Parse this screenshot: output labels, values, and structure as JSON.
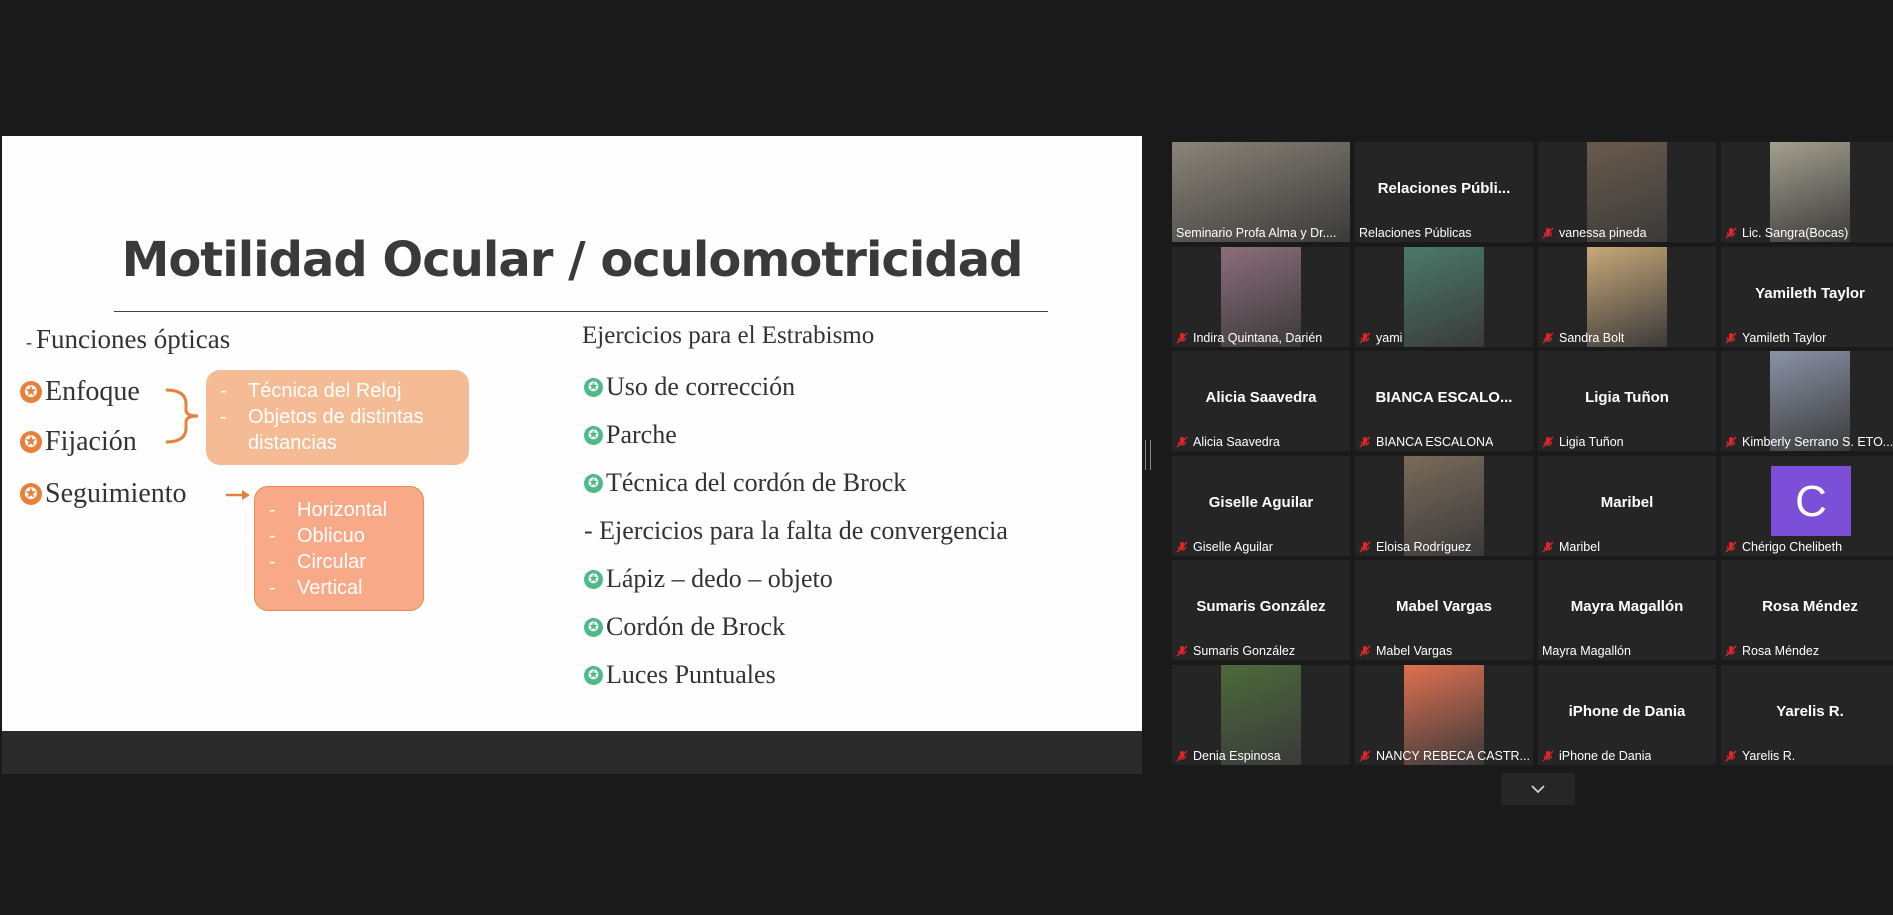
{
  "slide": {
    "title": "Motilidad Ocular / oculomotricidad",
    "left_heading_dash": "-",
    "left_heading": "Funciones ópticas",
    "items": [
      "Enfoque",
      "Fijación",
      "Seguimiento"
    ],
    "box1": [
      "Técnica del Reloj",
      "Objetos de distintas distancias"
    ],
    "box2": [
      "Horizontal",
      "Oblicuo",
      "Circular",
      "Vertical"
    ],
    "right_heading": "Ejercicios para el Estrabismo",
    "right_items_1": [
      "Uso de corrección",
      "Parche",
      "Técnica del cordón de Brock"
    ],
    "right_subheading": "- Ejercicios para la falta de convergencia",
    "right_items_2": [
      "Lápiz – dedo – objeto",
      "Cordón de Brock",
      "Luces Puntuales"
    ]
  },
  "gallery": [
    {
      "name": "Seminario Profa Alma y Dr....",
      "center": "",
      "video": true,
      "muted": false,
      "active": true
    },
    {
      "name": "Relaciones Públicas",
      "center": "Relaciones  Públi...",
      "video": false,
      "muted": false
    },
    {
      "name": "vanessa pineda",
      "center": "",
      "video": true,
      "muted": true
    },
    {
      "name": "Lic. Sangra(Bocas)",
      "center": "",
      "video": true,
      "muted": true
    },
    {
      "name": "Indira Quintana, Darién",
      "center": "",
      "video": true,
      "muted": true
    },
    {
      "name": "yami",
      "center": "",
      "video": true,
      "muted": true
    },
    {
      "name": "Sandra Bolt",
      "center": "",
      "video": true,
      "muted": true
    },
    {
      "name": "Yamileth Taylor",
      "center": "Yamileth Taylor",
      "video": false,
      "muted": true
    },
    {
      "name": "Alicia Saavedra",
      "center": "Alicia Saavedra",
      "video": false,
      "muted": true
    },
    {
      "name": "BIANCA ESCALONA",
      "center": "BIANCA  ESCALO...",
      "video": false,
      "muted": true
    },
    {
      "name": "Ligia Tuñon",
      "center": "Ligia Tuñon",
      "video": false,
      "muted": true
    },
    {
      "name": "Kimberly Serrano S. ETO...",
      "center": "",
      "video": true,
      "muted": true
    },
    {
      "name": "Giselle Aguilar",
      "center": "Giselle Aguilar",
      "video": false,
      "muted": true
    },
    {
      "name": "Eloisa Rodríguez",
      "center": "",
      "video": true,
      "muted": true
    },
    {
      "name": "Maribel",
      "center": "Maribel",
      "video": false,
      "muted": true
    },
    {
      "name": "Chérigo Chelibeth",
      "center": "",
      "video": false,
      "muted": true,
      "avatar": "C"
    },
    {
      "name": "Sumaris González",
      "center": "Sumaris González",
      "video": false,
      "muted": true
    },
    {
      "name": "Mabel Vargas",
      "center": "Mabel Vargas",
      "video": false,
      "muted": true
    },
    {
      "name": "Mayra Magallón",
      "center": "Mayra Magallón",
      "video": false,
      "muted": false
    },
    {
      "name": "Rosa Méndez",
      "center": "Rosa Méndez",
      "video": false,
      "muted": true
    },
    {
      "name": "Denia Espinosa",
      "center": "",
      "video": true,
      "muted": true
    },
    {
      "name": "NANCY REBECA CASTR...",
      "center": "",
      "video": true,
      "muted": true
    },
    {
      "name": "iPhone de Dania",
      "center": "iPhone de Dania",
      "video": false,
      "muted": true
    },
    {
      "name": "Yarelis R.",
      "center": "Yarelis R.",
      "video": false,
      "muted": true
    }
  ],
  "colors": {
    "active_border": "#d2e25e",
    "mute_red": "#e0262c",
    "orange_star": "#e8803a",
    "green_star": "#4fb98a"
  }
}
